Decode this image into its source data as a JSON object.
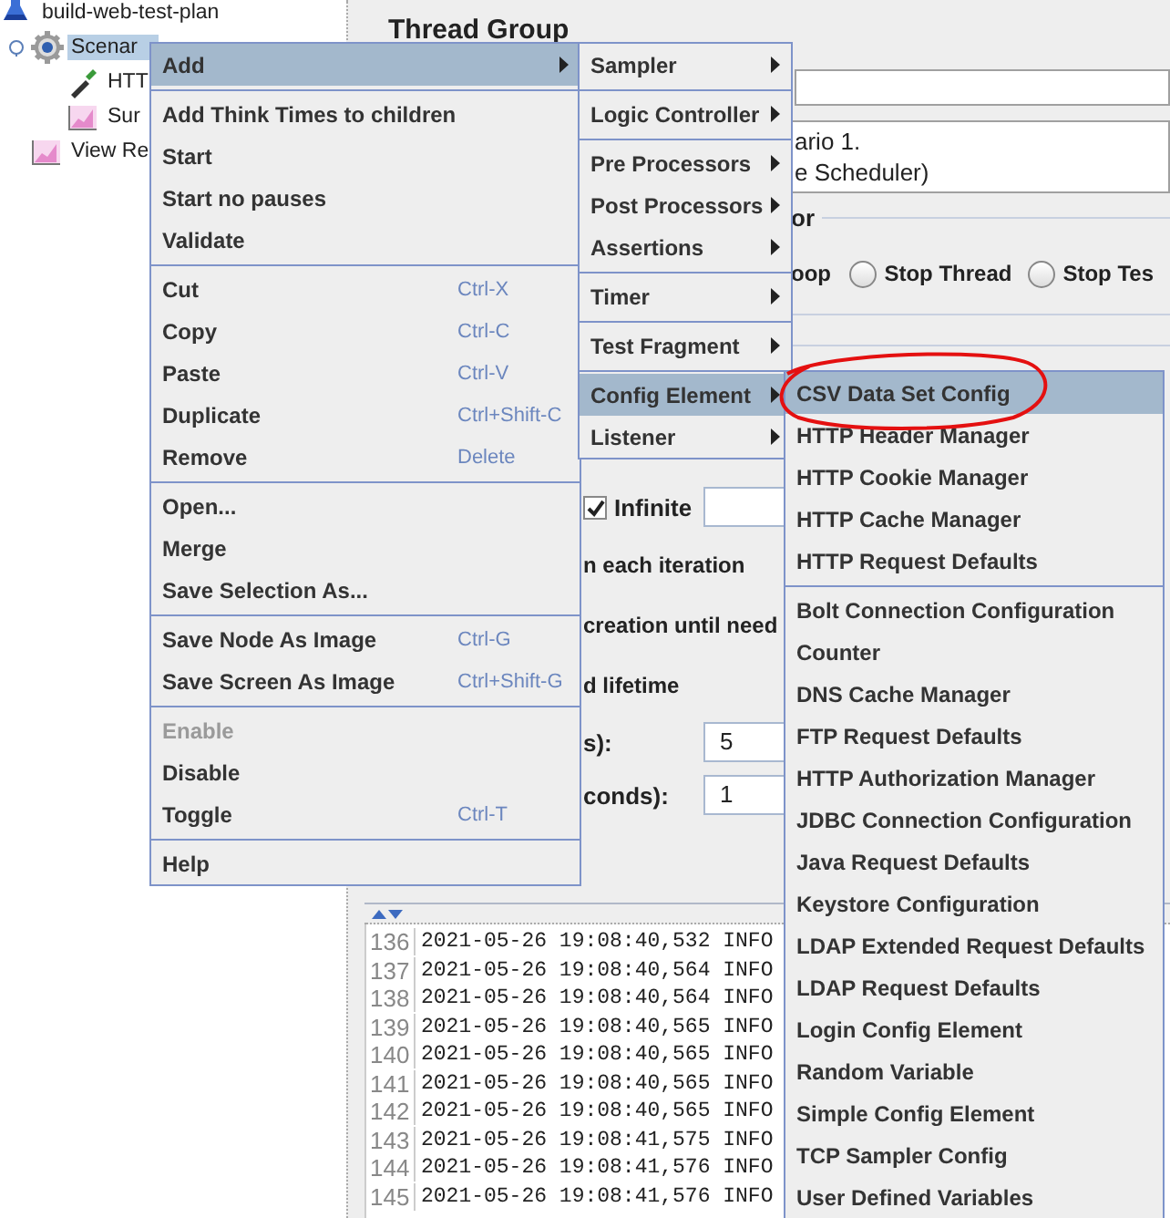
{
  "tree": [
    {
      "label": "build-web-test-plan",
      "kind": "test-plan",
      "selected": false,
      "children": [
        {
          "label": "Scenar",
          "kind": "thread-group",
          "selected": true,
          "expanded": true,
          "children": [
            {
              "label": "HTT",
              "kind": "sampler",
              "selected": false
            },
            {
              "label": "Sur",
              "kind": "listener",
              "selected": false
            }
          ]
        },
        {
          "label": "View Re",
          "kind": "listener",
          "selected": false
        }
      ]
    }
  ],
  "thread_group": {
    "title": "Thread Group",
    "comment_lines": [
      "ario 1.",
      "e Scheduler)"
    ],
    "error_section": "or",
    "error_action_partial": "oop",
    "error_actions": [
      {
        "label": "Stop Thread",
        "selected": false
      },
      {
        "label": "Stop Tes",
        "selected": false
      }
    ],
    "infinite": {
      "label": "Infinite",
      "checked": true
    },
    "fragments": [
      "n each iteration",
      "creation until need",
      "d lifetime"
    ],
    "fields": [
      {
        "label": "s):",
        "value": "5"
      },
      {
        "label": "conds):",
        "value": "1"
      }
    ]
  },
  "log": [
    {
      "number": "136",
      "text": "2021-05-26 19:08:40,532 INFO"
    },
    {
      "number": "137",
      "text": "2021-05-26 19:08:40,564 INFO"
    },
    {
      "number": "138",
      "text": "2021-05-26 19:08:40,564 INFO"
    },
    {
      "number": "139",
      "text": "2021-05-26 19:08:40,565 INFO"
    },
    {
      "number": "140",
      "text": "2021-05-26 19:08:40,565 INFO"
    },
    {
      "number": "141",
      "text": "2021-05-26 19:08:40,565 INFO"
    },
    {
      "number": "142",
      "text": "2021-05-26 19:08:40,565 INFO"
    },
    {
      "number": "143",
      "text": "2021-05-26 19:08:41,575 INFO"
    },
    {
      "number": "144",
      "text": "2021-05-26 19:08:41,576 INFO"
    },
    {
      "number": "145",
      "text": "2021-05-26 19:08:41,576 INFO"
    }
  ],
  "context_menus": [
    {
      "items": [
        {
          "kind": "item",
          "label": "Add",
          "submenu": true,
          "selected": true,
          "disabled": false
        },
        {
          "kind": "separator"
        },
        {
          "kind": "item",
          "label": "Add Think Times to children",
          "submenu": false,
          "selected": false,
          "disabled": false
        },
        {
          "kind": "item",
          "label": "Start",
          "submenu": false,
          "selected": false,
          "disabled": false
        },
        {
          "kind": "item",
          "label": "Start no pauses",
          "submenu": false,
          "selected": false,
          "disabled": false
        },
        {
          "kind": "item",
          "label": "Validate",
          "submenu": false,
          "selected": false,
          "disabled": false
        },
        {
          "kind": "separator"
        },
        {
          "kind": "item",
          "label": "Cut",
          "shortcut": "Ctrl-X",
          "submenu": false,
          "selected": false,
          "disabled": false
        },
        {
          "kind": "item",
          "label": "Copy",
          "shortcut": "Ctrl-C",
          "submenu": false,
          "selected": false,
          "disabled": false
        },
        {
          "kind": "item",
          "label": "Paste",
          "shortcut": "Ctrl-V",
          "submenu": false,
          "selected": false,
          "disabled": false
        },
        {
          "kind": "item",
          "label": "Duplicate",
          "shortcut": "Ctrl+Shift-C",
          "submenu": false,
          "selected": false,
          "disabled": false
        },
        {
          "kind": "item",
          "label": "Remove",
          "shortcut": "Delete",
          "submenu": false,
          "selected": false,
          "disabled": false
        },
        {
          "kind": "separator"
        },
        {
          "kind": "item",
          "label": "Open...",
          "submenu": false,
          "selected": false,
          "disabled": false
        },
        {
          "kind": "item",
          "label": "Merge",
          "submenu": false,
          "selected": false,
          "disabled": false
        },
        {
          "kind": "item",
          "label": "Save Selection As...",
          "submenu": false,
          "selected": false,
          "disabled": false
        },
        {
          "kind": "separator"
        },
        {
          "kind": "item",
          "label": "Save Node As Image",
          "shortcut": "Ctrl-G",
          "submenu": false,
          "selected": false,
          "disabled": false
        },
        {
          "kind": "item",
          "label": "Save Screen As Image",
          "shortcut": "Ctrl+Shift-G",
          "submenu": false,
          "selected": false,
          "disabled": false
        },
        {
          "kind": "separator"
        },
        {
          "kind": "item",
          "label": "Enable",
          "submenu": false,
          "selected": false,
          "disabled": true
        },
        {
          "kind": "item",
          "label": "Disable",
          "submenu": false,
          "selected": false,
          "disabled": false
        },
        {
          "kind": "item",
          "label": "Toggle",
          "shortcut": "Ctrl-T",
          "submenu": false,
          "selected": false,
          "disabled": false
        },
        {
          "kind": "separator"
        },
        {
          "kind": "item",
          "label": "Help",
          "submenu": false,
          "selected": false,
          "disabled": false
        }
      ]
    },
    {
      "items": [
        {
          "kind": "item",
          "label": "Sampler",
          "submenu": true,
          "selected": false,
          "disabled": false
        },
        {
          "kind": "separator"
        },
        {
          "kind": "item",
          "label": "Logic Controller",
          "submenu": true,
          "selected": false,
          "disabled": false
        },
        {
          "kind": "separator"
        },
        {
          "kind": "item",
          "label": "Pre Processors",
          "submenu": true,
          "selected": false,
          "disabled": false
        },
        {
          "kind": "item",
          "label": "Post Processors",
          "submenu": true,
          "selected": false,
          "disabled": false
        },
        {
          "kind": "item",
          "label": "Assertions",
          "submenu": true,
          "selected": false,
          "disabled": false
        },
        {
          "kind": "separator"
        },
        {
          "kind": "item",
          "label": "Timer",
          "submenu": true,
          "selected": false,
          "disabled": false
        },
        {
          "kind": "separator"
        },
        {
          "kind": "item",
          "label": "Test Fragment",
          "submenu": true,
          "selected": false,
          "disabled": false
        },
        {
          "kind": "separator"
        },
        {
          "kind": "item",
          "label": "Config Element",
          "submenu": true,
          "selected": true,
          "disabled": false
        },
        {
          "kind": "item",
          "label": "Listener",
          "submenu": true,
          "selected": false,
          "disabled": false
        }
      ]
    },
    {
      "items": [
        {
          "kind": "item",
          "label": "CSV Data Set Config",
          "submenu": false,
          "selected": true,
          "disabled": false
        },
        {
          "kind": "item",
          "label": "HTTP Header Manager",
          "submenu": false,
          "selected": false,
          "disabled": false
        },
        {
          "kind": "item",
          "label": "HTTP Cookie Manager",
          "submenu": false,
          "selected": false,
          "disabled": false
        },
        {
          "kind": "item",
          "label": "HTTP Cache Manager",
          "submenu": false,
          "selected": false,
          "disabled": false
        },
        {
          "kind": "item",
          "label": "HTTP Request Defaults",
          "submenu": false,
          "selected": false,
          "disabled": false
        },
        {
          "kind": "separator"
        },
        {
          "kind": "item",
          "label": "Bolt Connection Configuration",
          "submenu": false,
          "selected": false,
          "disabled": false
        },
        {
          "kind": "item",
          "label": "Counter",
          "submenu": false,
          "selected": false,
          "disabled": false
        },
        {
          "kind": "item",
          "label": "DNS Cache Manager",
          "submenu": false,
          "selected": false,
          "disabled": false
        },
        {
          "kind": "item",
          "label": "FTP Request Defaults",
          "submenu": false,
          "selected": false,
          "disabled": false
        },
        {
          "kind": "item",
          "label": "HTTP Authorization Manager",
          "submenu": false,
          "selected": false,
          "disabled": false
        },
        {
          "kind": "item",
          "label": "JDBC Connection Configuration",
          "submenu": false,
          "selected": false,
          "disabled": false
        },
        {
          "kind": "item",
          "label": "Java Request Defaults",
          "submenu": false,
          "selected": false,
          "disabled": false
        },
        {
          "kind": "item",
          "label": "Keystore Configuration",
          "submenu": false,
          "selected": false,
          "disabled": false
        },
        {
          "kind": "item",
          "label": "LDAP Extended Request Defaults",
          "submenu": false,
          "selected": false,
          "disabled": false
        },
        {
          "kind": "item",
          "label": "LDAP Request Defaults",
          "submenu": false,
          "selected": false,
          "disabled": false
        },
        {
          "kind": "item",
          "label": "Login Config Element",
          "submenu": false,
          "selected": false,
          "disabled": false
        },
        {
          "kind": "item",
          "label": "Random Variable",
          "submenu": false,
          "selected": false,
          "disabled": false
        },
        {
          "kind": "item",
          "label": "Simple Config Element",
          "submenu": false,
          "selected": false,
          "disabled": false
        },
        {
          "kind": "item",
          "label": "TCP Sampler Config",
          "submenu": false,
          "selected": false,
          "disabled": false
        },
        {
          "kind": "item",
          "label": "User Defined Variables",
          "submenu": false,
          "selected": false,
          "disabled": false
        }
      ]
    }
  ]
}
